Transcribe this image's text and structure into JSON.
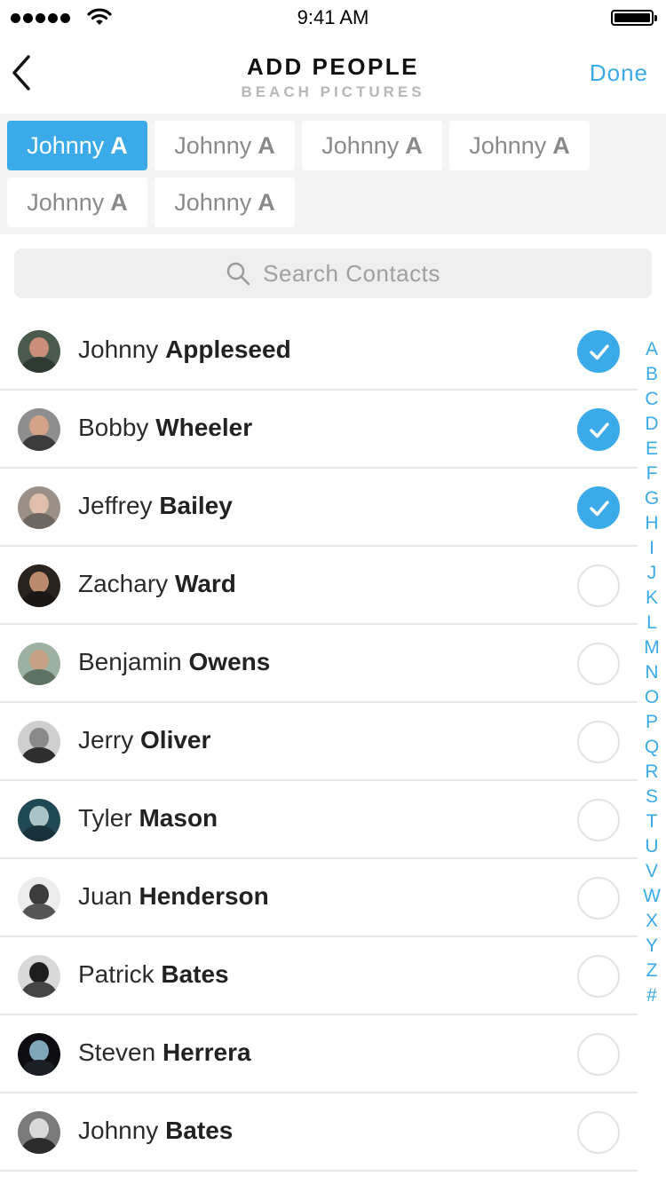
{
  "status_bar": {
    "time": "9:41 AM",
    "signal_icon": "signal-dots-icon",
    "wifi_icon": "wifi-icon",
    "battery_icon": "battery-icon"
  },
  "nav": {
    "title": "ADD PEOPLE",
    "subtitle": "BEACH PICTURES",
    "done_label": "Done",
    "back_icon": "chevron-left-icon"
  },
  "chips": [
    {
      "first": "Johnny",
      "initial": "A",
      "active": true
    },
    {
      "first": "Johnny",
      "initial": "A",
      "active": false
    },
    {
      "first": "Johnny",
      "initial": "A",
      "active": false
    },
    {
      "first": "Johnny",
      "initial": "A",
      "active": false
    },
    {
      "first": "Johnny",
      "initial": "A",
      "active": false
    },
    {
      "first": "Johnny",
      "initial": "A",
      "active": false
    }
  ],
  "search": {
    "placeholder": "Search Contacts",
    "icon": "search-icon"
  },
  "contacts": [
    {
      "first": "Johnny",
      "last": "Appleseed",
      "selected": true
    },
    {
      "first": "Bobby",
      "last": "Wheeler",
      "selected": true
    },
    {
      "first": "Jeffrey",
      "last": "Bailey",
      "selected": true
    },
    {
      "first": "Zachary",
      "last": "Ward",
      "selected": false
    },
    {
      "first": "Benjamin",
      "last": "Owens",
      "selected": false
    },
    {
      "first": "Jerry",
      "last": "Oliver",
      "selected": false
    },
    {
      "first": "Tyler",
      "last": "Mason",
      "selected": false
    },
    {
      "first": "Juan",
      "last": "Henderson",
      "selected": false
    },
    {
      "first": "Patrick",
      "last": "Bates",
      "selected": false
    },
    {
      "first": "Steven",
      "last": "Herrera",
      "selected": false
    },
    {
      "first": "Johnny",
      "last": "Bates",
      "selected": false
    }
  ],
  "index_letters": [
    "A",
    "B",
    "C",
    "D",
    "E",
    "F",
    "G",
    "H",
    "I",
    "J",
    "K",
    "L",
    "M",
    "N",
    "O",
    "P",
    "Q",
    "R",
    "S",
    "T",
    "U",
    "V",
    "W",
    "X",
    "Y",
    "Z",
    "#"
  ],
  "colors": {
    "accent": "#3aabe8",
    "chip_background": "#f4f4f4",
    "divider": "#e6e6e6"
  }
}
